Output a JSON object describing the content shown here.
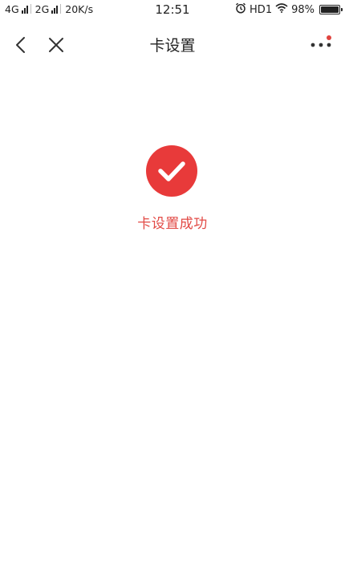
{
  "status_bar": {
    "net1": "4G",
    "net2": "2G",
    "speed": "20K/s",
    "time": "12:51",
    "hd": "HD1",
    "battery": "98%",
    "battery_level": 0.98
  },
  "nav": {
    "title": "卡设置",
    "icons": {
      "back": "chevron-left-icon",
      "close": "close-icon",
      "more": "more-dots-icon",
      "notification": "red-dot"
    }
  },
  "result": {
    "icon": "check-circle-icon",
    "message": "卡设置成功",
    "accent_color": "#e83a3a"
  }
}
